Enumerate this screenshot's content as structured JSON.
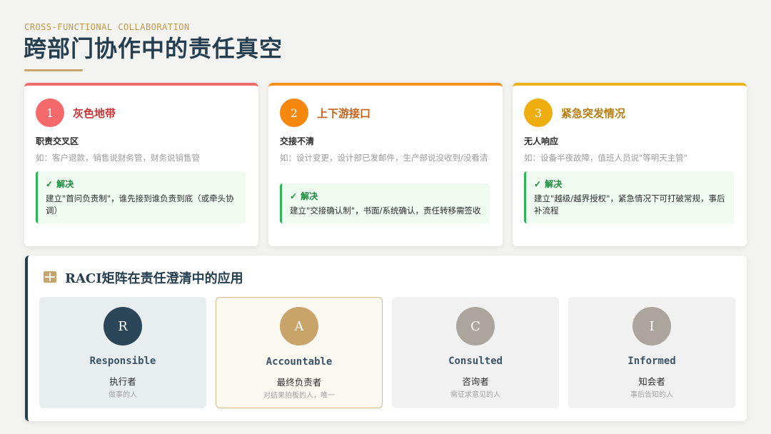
{
  "header": {
    "eyebrow": "CROSS-FUNCTIONAL COLLABORATION",
    "title": "跨部门协作中的责任真空"
  },
  "cards": [
    {
      "number": "1",
      "title": "灰色地带",
      "subtitle": "职责交叉区",
      "example": "如：客户退款，销售说财务管，财务说销售管",
      "solution_label": "解决",
      "solution_text": "建立\"首问负责制\"，谁先接到谁负责到底（或牵头协调）"
    },
    {
      "number": "2",
      "title": "上下游接口",
      "subtitle": "交接不清",
      "example": "如：设计变更，设计部已发邮件，生产部说没收到/没看清",
      "solution_label": "解决",
      "solution_text": "建立\"交接确认制\"，书面/系统确认，责任转移需签收"
    },
    {
      "number": "3",
      "title": "紧急突发情况",
      "subtitle": "无人响应",
      "example": "如：设备半夜故障，值班人员说\"等明天主管\"",
      "solution_label": "解决",
      "solution_text": "建立\"越级/越界授权\"，紧急情况下可打破常规，事后补流程"
    }
  ],
  "raci": {
    "title": "RACI矩阵在责任澄清中的应用",
    "roles": [
      {
        "letter": "R",
        "en": "Responsible",
        "cn": "执行者",
        "desc": "做事的人"
      },
      {
        "letter": "A",
        "en": "Accountable",
        "cn": "最终负责者",
        "desc": "对结果拍板的人，唯一"
      },
      {
        "letter": "C",
        "en": "Consulted",
        "cn": "咨询者",
        "desc": "需征求意见的人"
      },
      {
        "letter": "I",
        "en": "Informed",
        "cn": "知会者",
        "desc": "事后告知的人"
      }
    ]
  },
  "colors": {
    "navy": "#263f50",
    "gold": "#c8a46a",
    "card1": "#f06d6d",
    "card2": "#f3921f",
    "card3": "#f0b21a",
    "success": "#2fb45a"
  }
}
